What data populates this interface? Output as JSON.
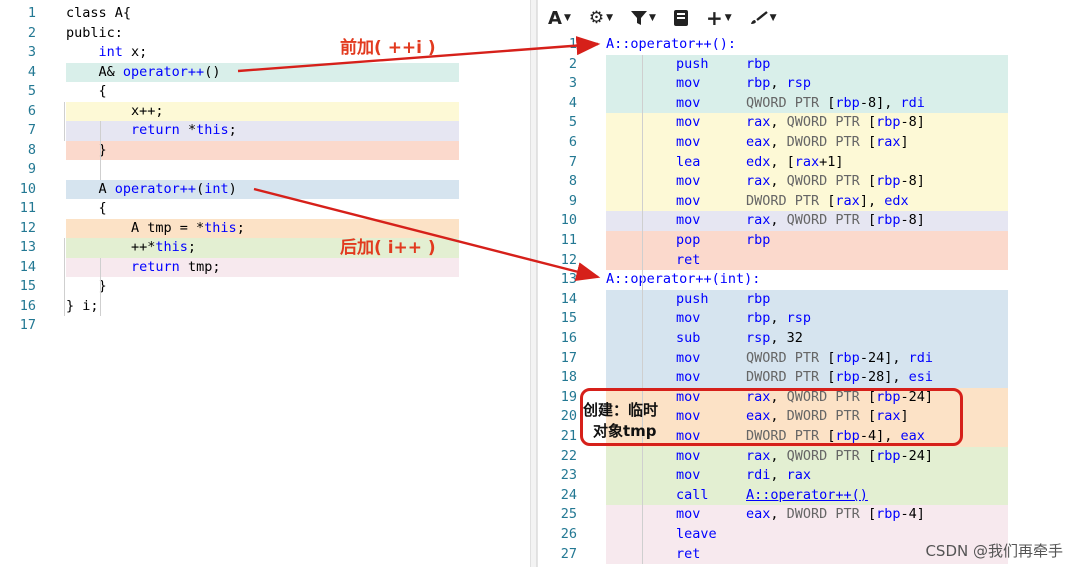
{
  "source": {
    "lines": [
      {
        "n": "1",
        "code": "class A{"
      },
      {
        "n": "2",
        "code": "public:"
      },
      {
        "n": "3",
        "code": "    int x;"
      },
      {
        "n": "4",
        "code": "    A& operator++()"
      },
      {
        "n": "5",
        "code": "    {"
      },
      {
        "n": "6",
        "code": "        x++;"
      },
      {
        "n": "7",
        "code": "        return *this;"
      },
      {
        "n": "8",
        "code": "    }"
      },
      {
        "n": "9",
        "code": ""
      },
      {
        "n": "10",
        "code": "    A operator++(int)"
      },
      {
        "n": "11",
        "code": "    {"
      },
      {
        "n": "12",
        "code": "        A tmp = *this;"
      },
      {
        "n": "13",
        "code": "        ++*this;"
      },
      {
        "n": "14",
        "code": "        return tmp;"
      },
      {
        "n": "15",
        "code": "    }"
      },
      {
        "n": "16",
        "code": "} i;"
      },
      {
        "n": "17",
        "code": ""
      }
    ],
    "highlight_colors": {
      "teal": "#d9efea",
      "yellow": "#fdf9d6",
      "lavender": "#e6e6f2",
      "salmon": "#fbd9cc",
      "blue": "#d6e4ef",
      "orange": "#fce2c6",
      "green": "#e3efd2",
      "pink": "#f7e9ee"
    }
  },
  "toolbar": {
    "items": [
      {
        "name": "font-size-icon",
        "glyph": "A"
      },
      {
        "name": "settings-icon",
        "glyph": "⚙"
      },
      {
        "name": "filter-icon",
        "glyph": "▼"
      },
      {
        "name": "library-icon",
        "glyph": "▮"
      },
      {
        "name": "add-icon",
        "glyph": "+"
      },
      {
        "name": "tools-icon",
        "glyph": "✎"
      }
    ]
  },
  "assembly": {
    "lines": [
      {
        "n": "1",
        "label": "A::operator++():"
      },
      {
        "n": "2",
        "op": "push",
        "args": "rbp"
      },
      {
        "n": "3",
        "op": "mov",
        "args": "rbp, rsp"
      },
      {
        "n": "4",
        "op": "mov",
        "args": "QWORD PTR [rbp-8], rdi"
      },
      {
        "n": "5",
        "op": "mov",
        "args": "rax, QWORD PTR [rbp-8]"
      },
      {
        "n": "6",
        "op": "mov",
        "args": "eax, DWORD PTR [rax]"
      },
      {
        "n": "7",
        "op": "lea",
        "args": "edx, [rax+1]"
      },
      {
        "n": "8",
        "op": "mov",
        "args": "rax, QWORD PTR [rbp-8]"
      },
      {
        "n": "9",
        "op": "mov",
        "args": "DWORD PTR [rax], edx"
      },
      {
        "n": "10",
        "op": "mov",
        "args": "rax, QWORD PTR [rbp-8]"
      },
      {
        "n": "11",
        "op": "pop",
        "args": "rbp"
      },
      {
        "n": "12",
        "op": "ret",
        "args": ""
      },
      {
        "n": "13",
        "label": "A::operator++(int):"
      },
      {
        "n": "14",
        "op": "push",
        "args": "rbp"
      },
      {
        "n": "15",
        "op": "mov",
        "args": "rbp, rsp"
      },
      {
        "n": "16",
        "op": "sub",
        "args": "rsp, 32"
      },
      {
        "n": "17",
        "op": "mov",
        "args": "QWORD PTR [rbp-24], rdi"
      },
      {
        "n": "18",
        "op": "mov",
        "args": "DWORD PTR [rbp-28], esi"
      },
      {
        "n": "19",
        "op": "mov",
        "args": "rax, QWORD PTR [rbp-24]"
      },
      {
        "n": "20",
        "op": "mov",
        "args": "eax, DWORD PTR [rax]"
      },
      {
        "n": "21",
        "op": "mov",
        "args": "DWORD PTR [rbp-4], eax"
      },
      {
        "n": "22",
        "op": "mov",
        "args": "rax, QWORD PTR [rbp-24]"
      },
      {
        "n": "23",
        "op": "mov",
        "args": "rdi, rax"
      },
      {
        "n": "24",
        "op": "call",
        "args": "A::operator++()"
      },
      {
        "n": "25",
        "op": "mov",
        "args": "eax, DWORD PTR [rbp-4]"
      },
      {
        "n": "26",
        "op": "leave",
        "args": ""
      },
      {
        "n": "27",
        "op": "ret",
        "args": ""
      }
    ]
  },
  "annotations": {
    "prefix_label": "前加( ++i )",
    "postfix_label": "后加( i++ )",
    "callout_line1": "创建：临时",
    "callout_line2": "对象tmp",
    "arrow_color": "#d6201a"
  },
  "watermark": "CSDN @我们再牵手"
}
